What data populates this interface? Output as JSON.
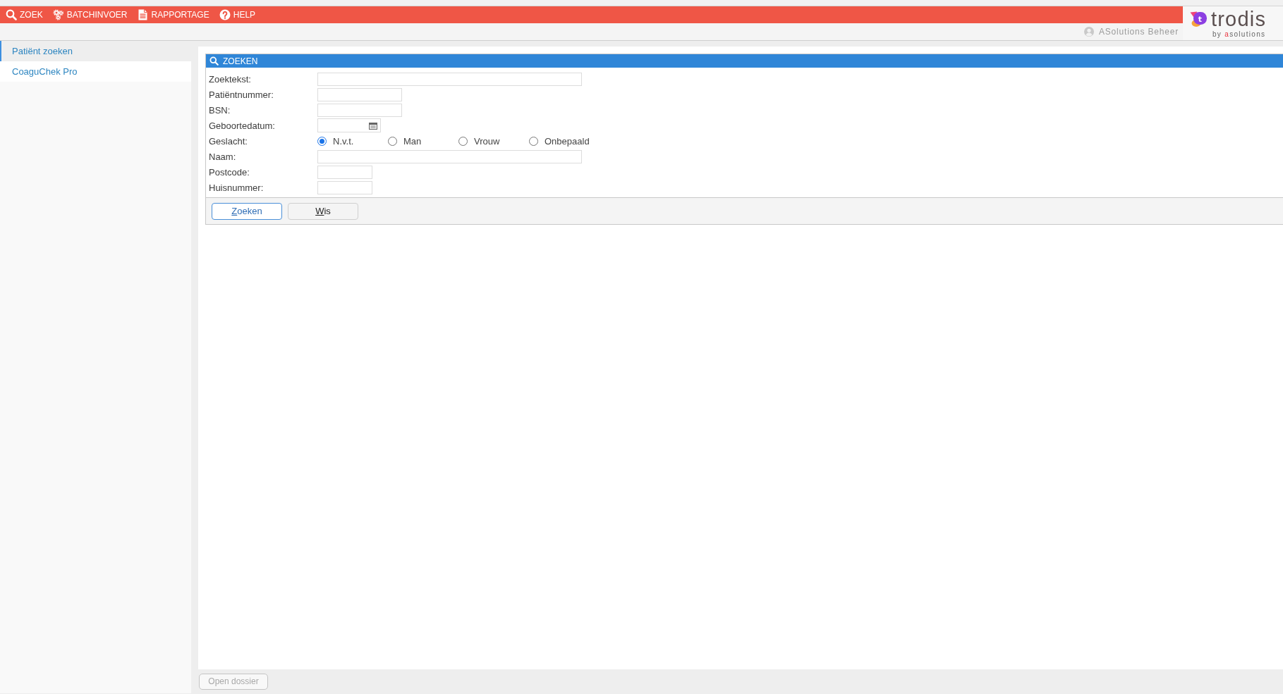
{
  "menu": [
    {
      "label": "ZOEK"
    },
    {
      "label": "BATCHINVOER"
    },
    {
      "label": "RAPPORTAGE"
    },
    {
      "label": "HELP"
    }
  ],
  "user": {
    "name": "ASolutions Beheer"
  },
  "logo": {
    "mark": "t",
    "name": "trodis",
    "tagline": "by",
    "company": "asolutions"
  },
  "sidebar": {
    "items": [
      {
        "label": "Patiënt zoeken",
        "selected": true
      },
      {
        "label": "CoaguChek Pro",
        "selected": false
      }
    ]
  },
  "search_panel": {
    "title": "ZOEKEN",
    "fields": [
      {
        "kind": "text",
        "label": "Zoektekst:"
      },
      {
        "kind": "text",
        "label": "Patiëntnummer:"
      },
      {
        "kind": "text",
        "label": "BSN:"
      },
      {
        "kind": "date",
        "label": "Geboortedatum:"
      },
      {
        "kind": "radio",
        "label": "Geslacht:",
        "options": [
          {
            "label": "N.v.t.",
            "selected": true
          },
          {
            "label": "Man",
            "selected": false
          },
          {
            "label": "Vrouw",
            "selected": false
          },
          {
            "label": "Onbepaald",
            "selected": false
          }
        ]
      },
      {
        "kind": "text",
        "label": "Naam:"
      },
      {
        "kind": "text",
        "label": "Postcode:"
      },
      {
        "kind": "text",
        "label": "Huisnummer:"
      }
    ],
    "buttons": [
      {
        "label": "Zoeken",
        "focused": true
      },
      {
        "label": "Wis",
        "focused": false
      }
    ]
  },
  "footer": {
    "buttons": [
      {
        "label": "Open dossier",
        "disabled": true
      }
    ]
  }
}
